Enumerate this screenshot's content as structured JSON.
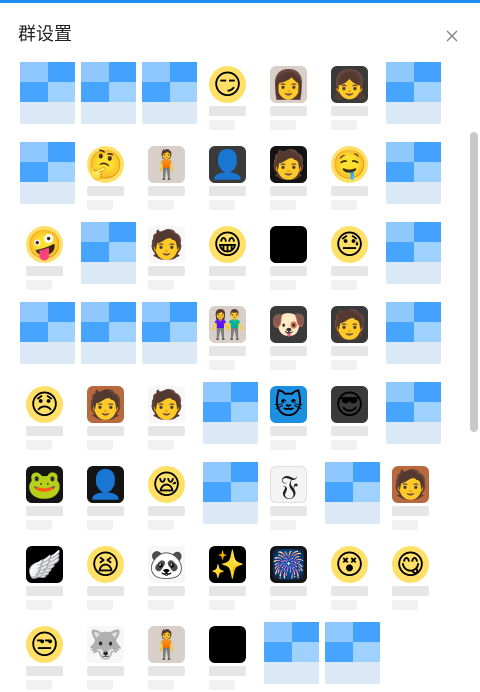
{
  "window": {
    "title": "群设置",
    "close_icon": "close-icon"
  },
  "colors": {
    "accent": "#1e8cf0",
    "mosaic_blue": "#44a2ff",
    "mosaic_light": "#9fd1ff"
  },
  "members": [
    {
      "kind": "mosaic"
    },
    {
      "kind": "mosaic"
    },
    {
      "kind": "mosaic"
    },
    {
      "kind": "emoji",
      "glyph": "😏"
    },
    {
      "kind": "photo",
      "tone": "light",
      "glyph": "👩"
    },
    {
      "kind": "photo",
      "tone": "",
      "glyph": "👧"
    },
    {
      "kind": "mosaic"
    },
    {
      "kind": "mosaic"
    },
    {
      "kind": "emoji",
      "glyph": "🤔"
    },
    {
      "kind": "photo",
      "tone": "light",
      "glyph": "🧍"
    },
    {
      "kind": "photo",
      "tone": "",
      "glyph": "👤"
    },
    {
      "kind": "photo",
      "tone": "dark",
      "glyph": "🧑"
    },
    {
      "kind": "emoji",
      "glyph": "🤤"
    },
    {
      "kind": "mosaic"
    },
    {
      "kind": "emoji",
      "glyph": "🤪"
    },
    {
      "kind": "mosaic"
    },
    {
      "kind": "sticker",
      "glyph": "🧑"
    },
    {
      "kind": "emoji",
      "glyph": "😁"
    },
    {
      "kind": "photo",
      "tone": "black",
      "glyph": ""
    },
    {
      "kind": "emoji",
      "glyph": "😓"
    },
    {
      "kind": "mosaic"
    },
    {
      "kind": "mosaic"
    },
    {
      "kind": "mosaic"
    },
    {
      "kind": "mosaic"
    },
    {
      "kind": "photo",
      "tone": "light",
      "glyph": "👫"
    },
    {
      "kind": "photo",
      "tone": "",
      "glyph": "🐶"
    },
    {
      "kind": "photo",
      "tone": "",
      "glyph": "🧑"
    },
    {
      "kind": "mosaic"
    },
    {
      "kind": "emoji",
      "glyph": "😞"
    },
    {
      "kind": "photo",
      "tone": "warm",
      "glyph": "🧑"
    },
    {
      "kind": "sticker",
      "glyph": "🧑"
    },
    {
      "kind": "mosaic"
    },
    {
      "kind": "photo",
      "tone": "blue",
      "glyph": "🐱"
    },
    {
      "kind": "photo",
      "tone": "",
      "glyph": "😎"
    },
    {
      "kind": "mosaic"
    },
    {
      "kind": "photo",
      "tone": "dark",
      "glyph": "🐸"
    },
    {
      "kind": "photo",
      "tone": "dark",
      "glyph": "👤"
    },
    {
      "kind": "emoji",
      "glyph": "😪"
    },
    {
      "kind": "mosaic"
    },
    {
      "kind": "photo",
      "tone": "bw",
      "glyph": "𝔉"
    },
    {
      "kind": "mosaic"
    },
    {
      "kind": "photo",
      "tone": "warm",
      "glyph": "🧑"
    },
    {
      "kind": "photo",
      "tone": "black",
      "glyph": "🪽"
    },
    {
      "kind": "emoji",
      "glyph": "😫"
    },
    {
      "kind": "sticker",
      "glyph": "🐼"
    },
    {
      "kind": "photo",
      "tone": "black",
      "glyph": "✨"
    },
    {
      "kind": "photo",
      "tone": "dark",
      "glyph": "🎆"
    },
    {
      "kind": "emoji",
      "glyph": "😵"
    },
    {
      "kind": "emoji",
      "glyph": "😋"
    },
    {
      "kind": "emoji",
      "glyph": "😒"
    },
    {
      "kind": "sticker",
      "glyph": "🐺"
    },
    {
      "kind": "photo",
      "tone": "light",
      "glyph": "🧍"
    },
    {
      "kind": "photo",
      "tone": "black",
      "glyph": ""
    },
    {
      "kind": "mosaic"
    },
    {
      "kind": "mosaic"
    }
  ]
}
